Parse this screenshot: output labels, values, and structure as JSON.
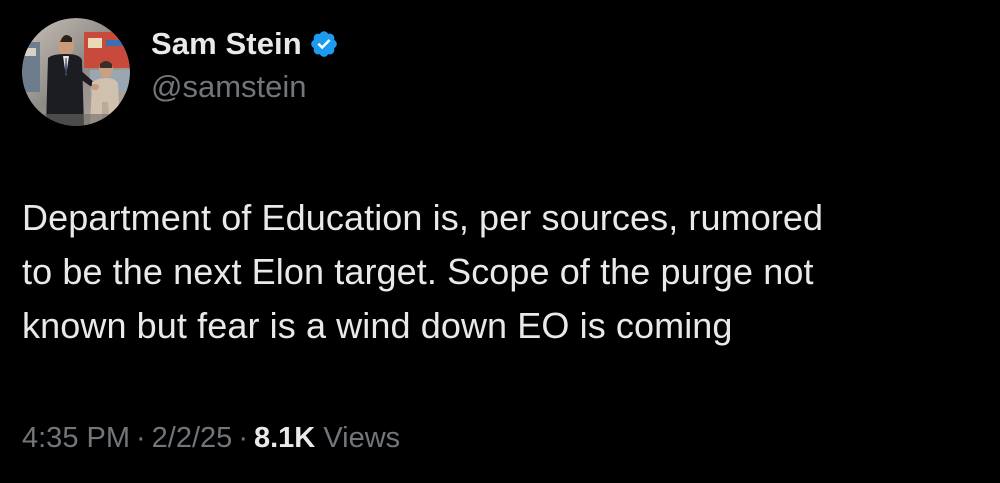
{
  "author": {
    "display_name": "Sam Stein",
    "handle": "@samstein",
    "verified": true,
    "verified_icon": "verified-badge-icon",
    "verified_color": "#1d9bf0"
  },
  "tweet": {
    "lines": [
      "Department of Education is, per sources, rumored",
      "to be the next Elon target. Scope of the purge not",
      "known but fear is a wind down EO is coming"
    ]
  },
  "meta": {
    "time": "4:35 PM",
    "separator": "·",
    "date": "2/2/25",
    "views_count": "8.1K",
    "views_label": "Views"
  },
  "colors": {
    "background": "#000000",
    "primary_text": "#e7e9ea",
    "secondary_text": "#71767b"
  }
}
